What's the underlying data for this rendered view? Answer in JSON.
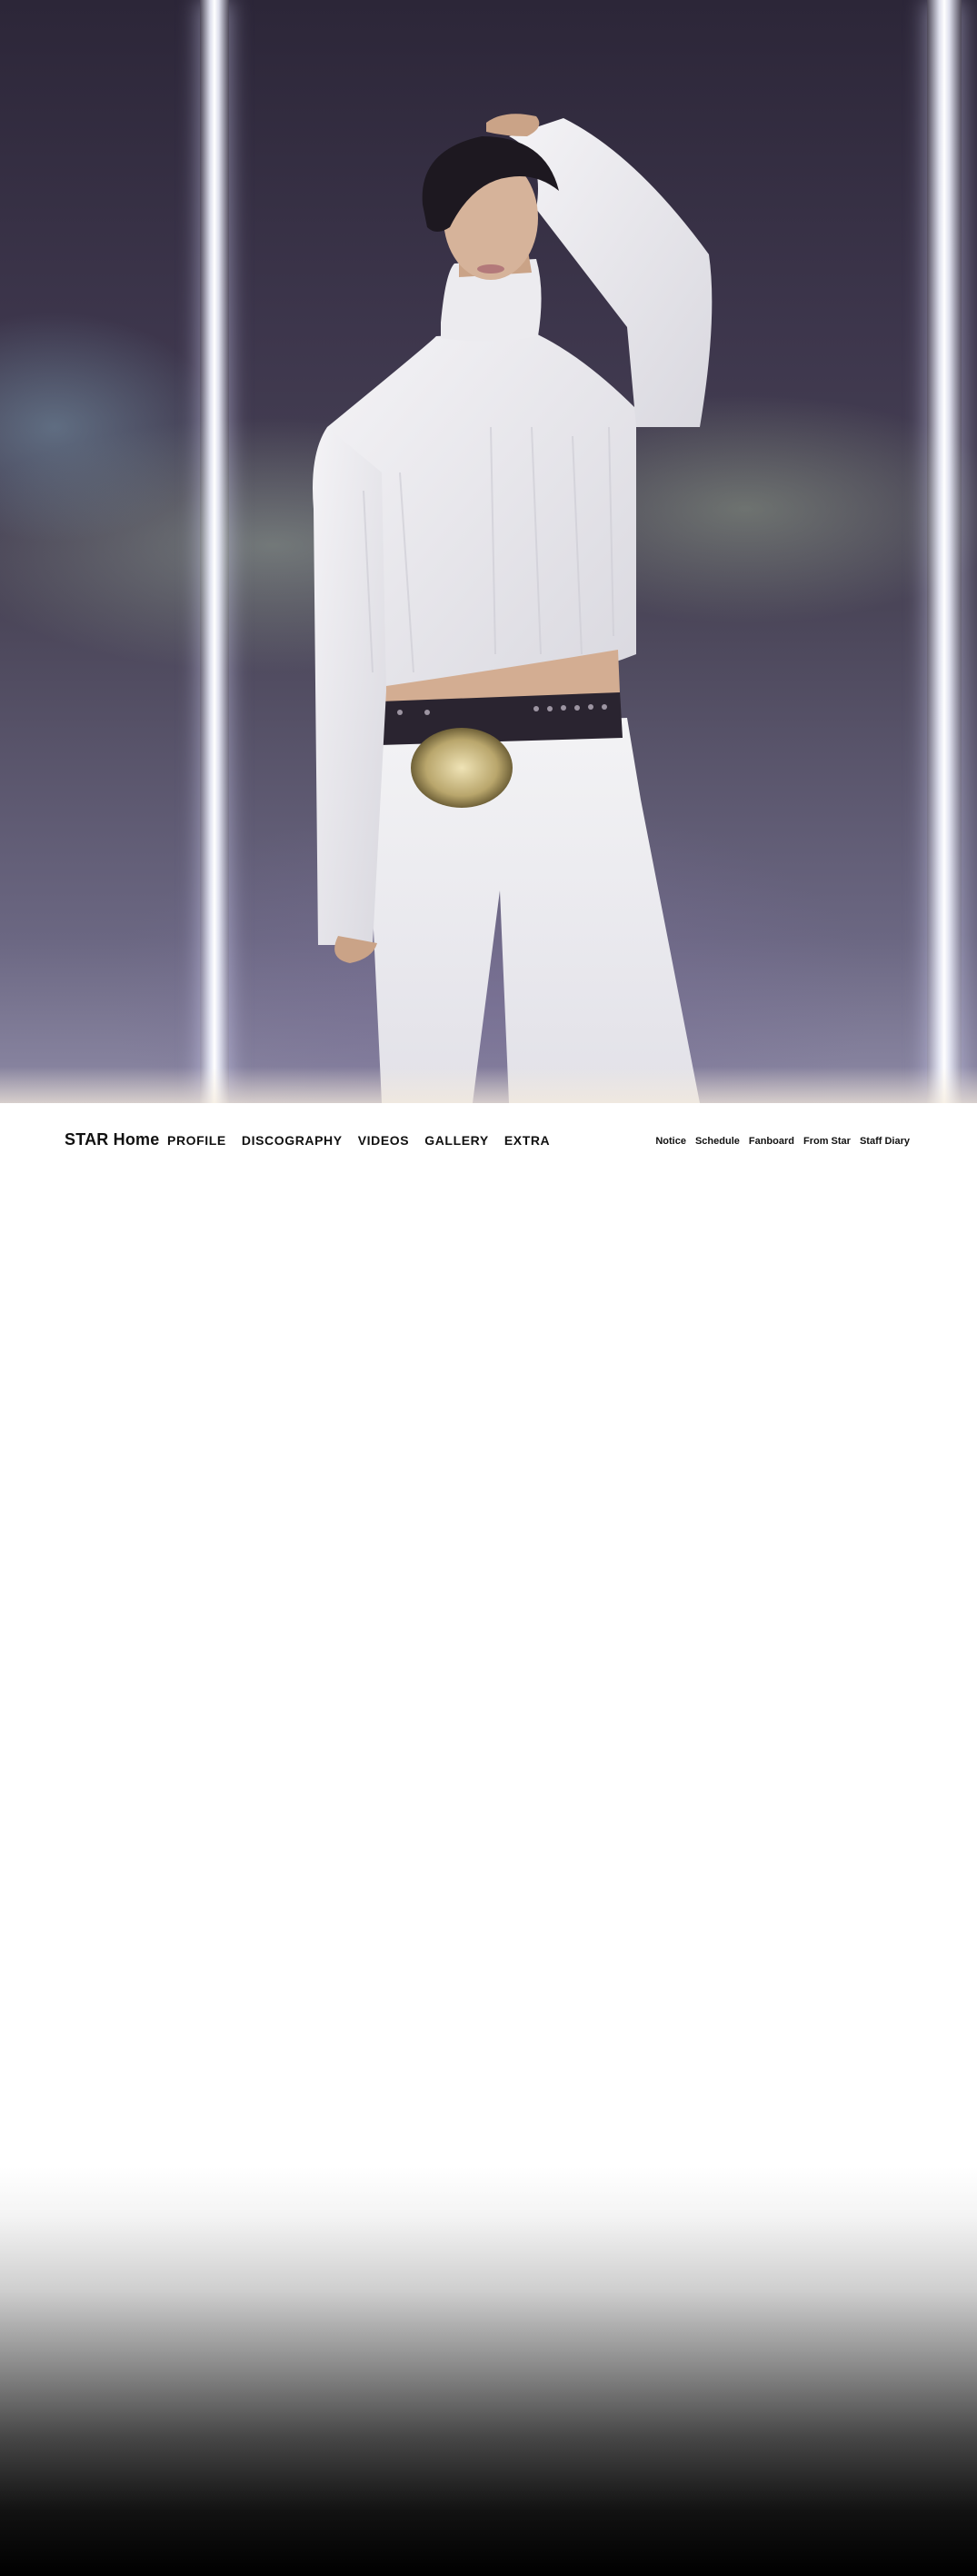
{
  "hero": {
    "image_description_icon": "artist-portrait-image"
  },
  "nav": {
    "brand": "STAR Home",
    "main_items": [
      {
        "label": "PROFILE"
      },
      {
        "label": "DISCOGRAPHY"
      },
      {
        "label": "VIDEOS"
      },
      {
        "label": "GALLERY"
      },
      {
        "label": "EXTRA"
      }
    ],
    "sub_items": [
      {
        "label": "Notice"
      },
      {
        "label": "Schedule"
      },
      {
        "label": "Fanboard"
      },
      {
        "label": "From Star"
      },
      {
        "label": "Staff Diary"
      }
    ]
  },
  "colors": {
    "nav_text": "#111111",
    "background": "#ffffff",
    "footer_fade_end": "#000000"
  }
}
